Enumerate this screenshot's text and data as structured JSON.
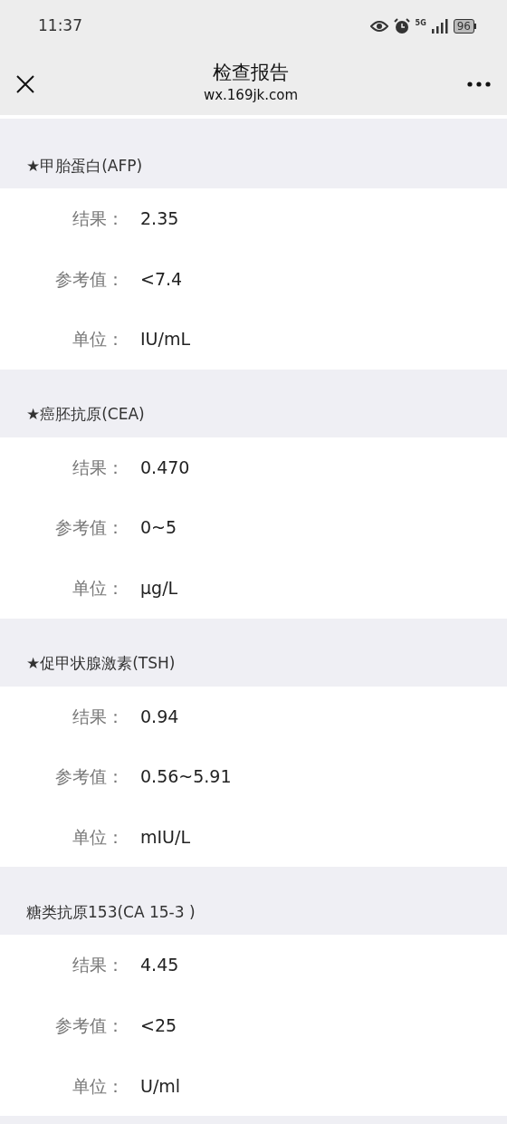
{
  "status_bar": {
    "time": "11:37",
    "network": "5G",
    "battery": "96"
  },
  "nav": {
    "title": "检查报告",
    "url": "wx.169jk.com"
  },
  "sections": [
    {
      "title": "★甲胎蛋白(AFP)",
      "rows": [
        {
          "label": "结果：",
          "value": "2.35"
        },
        {
          "label": "参考值：",
          "value": "<7.4"
        },
        {
          "label": "单位：",
          "value": "IU/mL"
        }
      ]
    },
    {
      "title": "★癌胚抗原(CEA)",
      "rows": [
        {
          "label": "结果：",
          "value": "0.470"
        },
        {
          "label": "参考值：",
          "value": "0~5"
        },
        {
          "label": "单位：",
          "value": "μg/L"
        }
      ]
    },
    {
      "title": "★促甲状腺激素(TSH)",
      "rows": [
        {
          "label": "结果：",
          "value": "0.94"
        },
        {
          "label": "参考值：",
          "value": "0.56~5.91"
        },
        {
          "label": "单位：",
          "value": "mIU/L"
        }
      ]
    },
    {
      "title": "糖类抗原153(CA 15-3 )",
      "rows": [
        {
          "label": "结果：",
          "value": "4.45"
        },
        {
          "label": "参考值：",
          "value": "<25"
        },
        {
          "label": "单位：",
          "value": "U/ml"
        }
      ]
    }
  ]
}
